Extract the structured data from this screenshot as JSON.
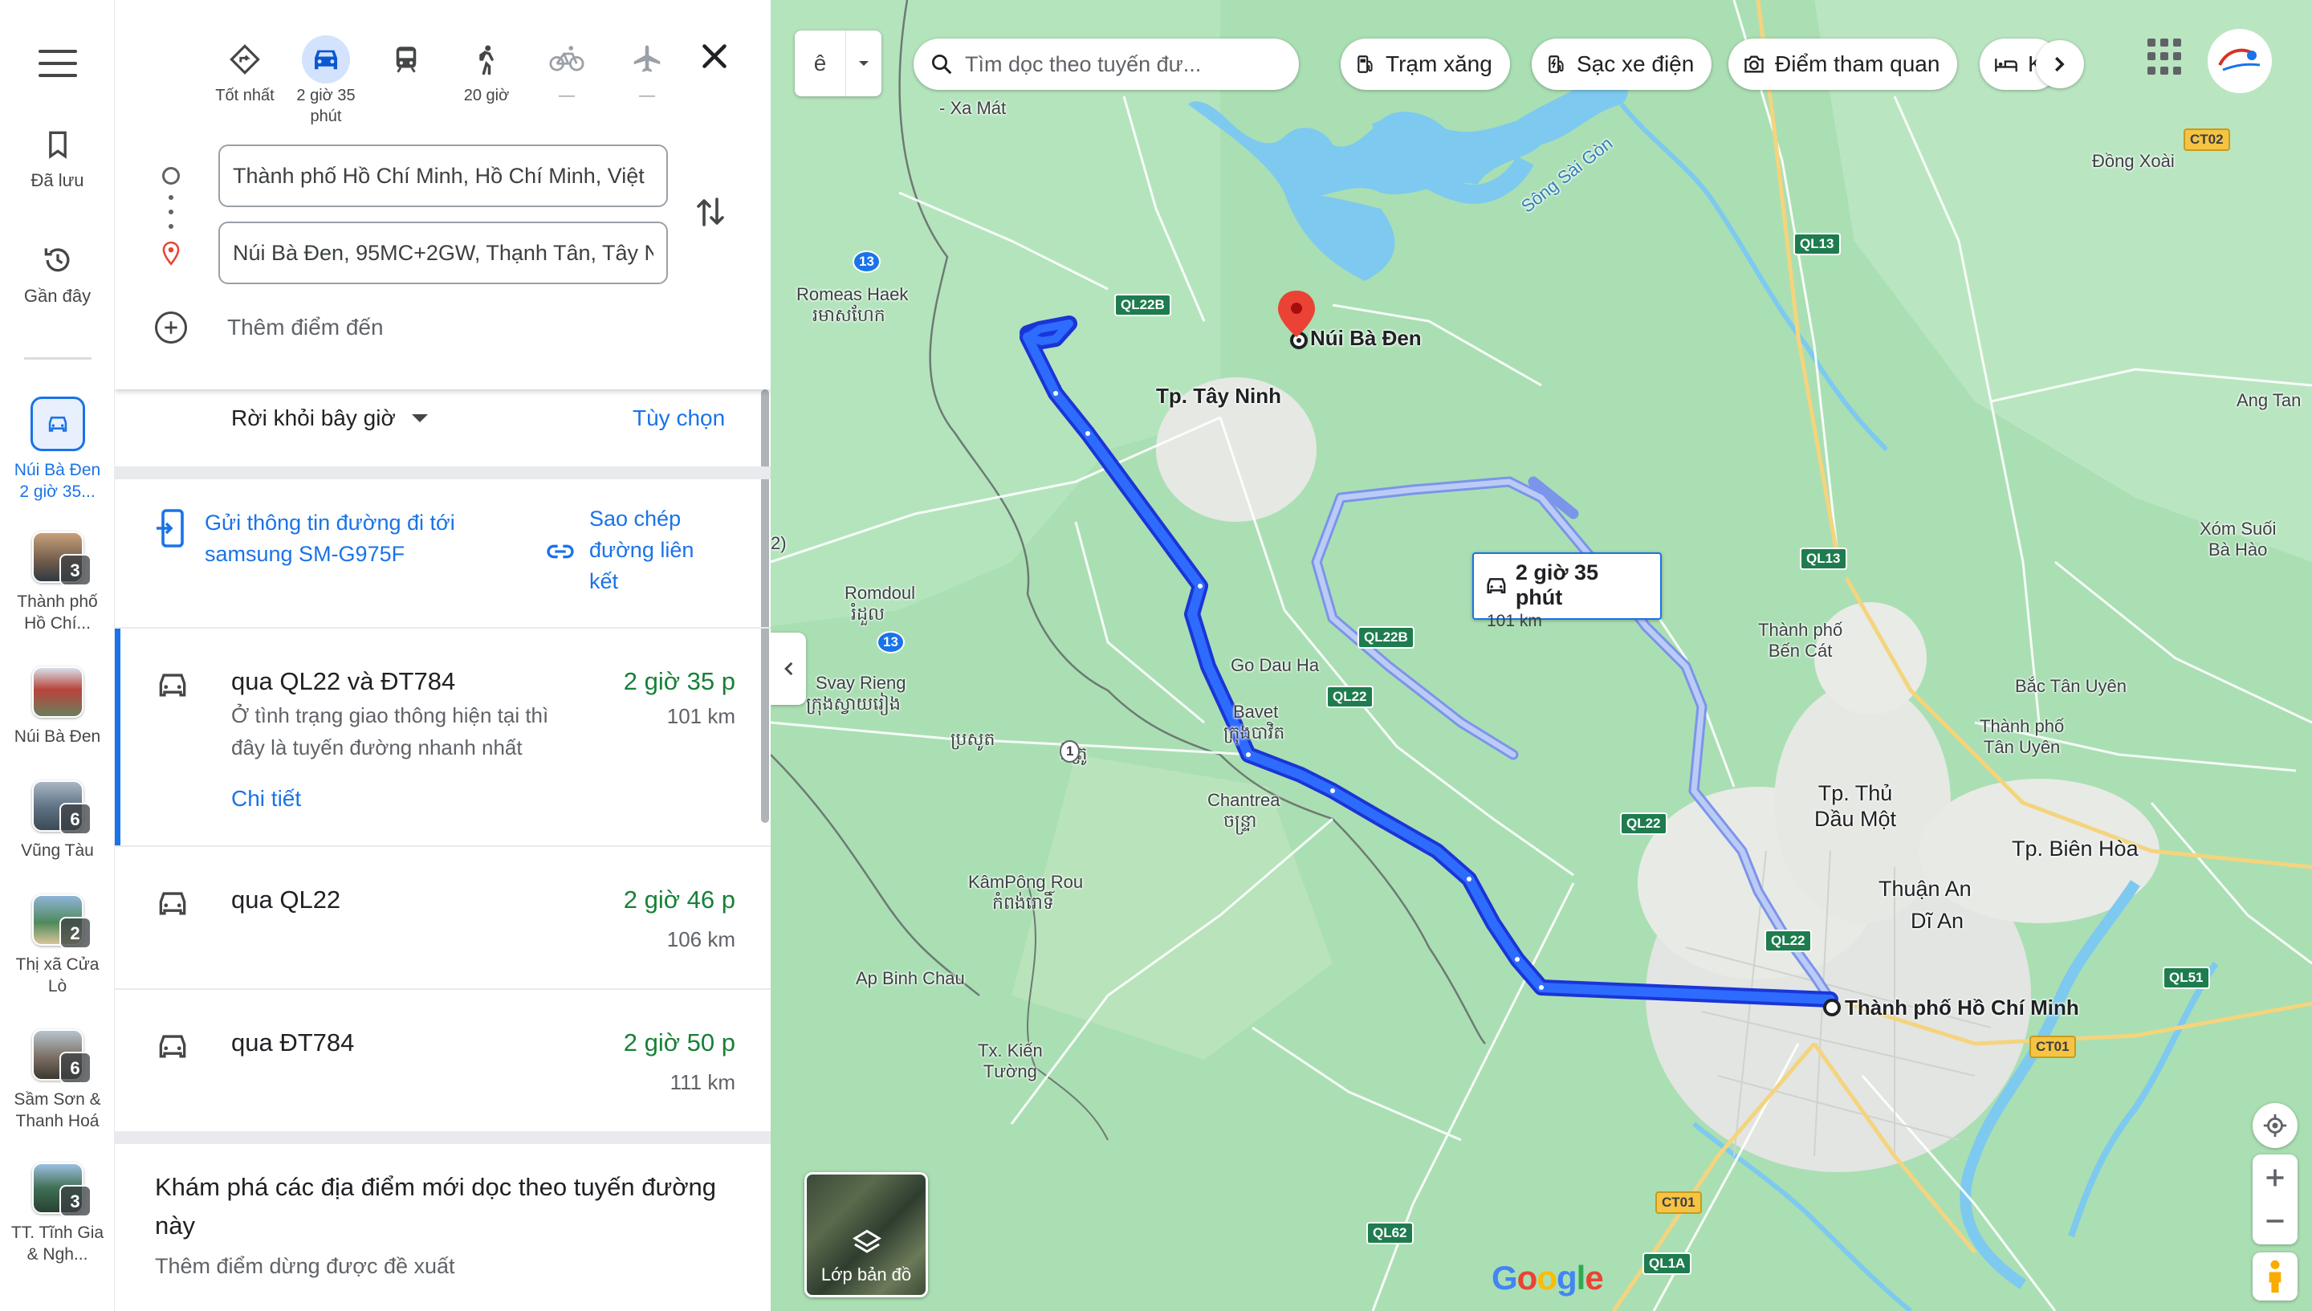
{
  "rail": {
    "saved_label": "Đã lưu",
    "recent_label": "Gần đây",
    "items": [
      {
        "label": "Núi Bà Đen 2 giờ 35...",
        "badge": ""
      },
      {
        "label": "Thành phố Hồ Chí...",
        "badge": "3"
      },
      {
        "label": "Núi Bà Đen",
        "badge": ""
      },
      {
        "label": "Vũng Tàu",
        "badge": "6"
      },
      {
        "label": "Thị xã Cửa Lò",
        "badge": "2"
      },
      {
        "label": "Sầm Sơn & Thanh Hoá",
        "badge": "6"
      },
      {
        "label": "TT. Tĩnh Gia & Ngh...",
        "badge": "3"
      }
    ]
  },
  "modes": [
    {
      "label": "Tốt nhất",
      "icon": "diamond-route-icon"
    },
    {
      "label": "2 giờ 35 phút",
      "icon": "car-icon"
    },
    {
      "label": "",
      "icon": "transit-icon"
    },
    {
      "label": "20 giờ",
      "icon": "walk-icon"
    },
    {
      "label": "—",
      "icon": "bike-icon"
    },
    {
      "label": "—",
      "icon": "plane-icon"
    }
  ],
  "origin": "Thành phố Hồ Chí Minh, Hồ Chí Minh, Việt",
  "destination": "Núi Bà Đen, 95MC+2GW, Thạnh Tân, Tây N",
  "add_destination": "Thêm điểm đến",
  "depart": "Rời khỏi bây giờ",
  "options": "Tùy chọn",
  "send": "Gửi thông tin đường đi tới samsung SM-G975F",
  "copy_link": "Sao chép đường liên kết",
  "routes": [
    {
      "name": "qua QL22 và ĐT784",
      "time": "2 giờ 35 p",
      "distance": "101 km",
      "desc": "Ở tình trạng giao thông hiện tại thì đây là tuyến đường nhanh nhất",
      "details": "Chi tiết"
    },
    {
      "name": "qua QL22",
      "time": "2 giờ 46 p",
      "distance": "106 km"
    },
    {
      "name": "qua ĐT784",
      "time": "2 giờ 50 p",
      "distance": "111 km"
    }
  ],
  "explore": {
    "title": "Khám phá các địa điểm mới dọc theo tuyến đường này",
    "subtitle": "Thêm điểm dừng được đề xuất"
  },
  "map": {
    "search_placeholder": "Tìm dọc theo tuyến đư...",
    "dropdown_icon": "ê",
    "chips": [
      "Trạm xăng",
      "Sạc xe điện",
      "Điểm tham quan",
      "Kh"
    ],
    "callout_time": "2 giờ 35 phút",
    "callout_distance": "101 km",
    "layers_label": "Lớp bản đồ",
    "google": "Google",
    "labels": {
      "xa_mat": "- Xa Mát",
      "romeas": "Romeas Haek",
      "romeas_km": "រមាសហែក",
      "tay_ninh": "Tp. Tây Ninh",
      "nui_ba_den": "Núi Bà Đen",
      "song_sai_gon": "Sông Sài Gòn",
      "dong_xoai": "Đồng Xoài",
      "ang_tan": "Ang Tan",
      "xom_suoi": "Xóm Suối\nBà Hào",
      "romdoul": "Romdoul",
      "romdoul_km": "រំដួល",
      "svay_rieng": "Svay Rieng",
      "svay_rieng_km": "ក្រុងស្វាយរៀង",
      "go_dau_ha": "Go Dau Ha",
      "bavet": "Bavet",
      "bavet_km": "ក្រុងបាវិត",
      "prasout": "ប្រសូត",
      "chantrea": "Chantrea",
      "chantrea_km": "ចន្ទ្រា",
      "ben_cat": "Thành phố\nBến Cát",
      "bac_tan_uyen": "Bắc Tân Uyên",
      "tan_uyen": "Thành phố\nTân Uyên",
      "thu_dau_mot": "Tp. Thủ\nDầu Một",
      "bien_hoa": "Tp. Biên Hòa",
      "thuan_an": "Thuận An",
      "di_an": "Dĩ An",
      "kampong_rou": "KâmPông Rou",
      "kampong_rou_km": "កំពង់រោទិ៍",
      "ap_binh_chau": "Ap Binh Chau",
      "kien_tuong": "Tx. Kiến\nTường",
      "hcm": "Thành phố Hồ Chí Minh",
      "chitrou": "ជិត្រូ",
      "shield_2": "2)"
    },
    "shields": {
      "ql22b_top": "QL22B",
      "ql13_top": "QL13",
      "ct02": "CT02",
      "r13": "13",
      "r1": "1",
      "ql13_mid": "QL13",
      "ql22b_mid": "QL22B",
      "ql22_left": "QL22",
      "ql22_mid": "QL22",
      "ql22_low": "QL22",
      "ql51": "QL51",
      "ct01_r": "CT01",
      "ct01_b": "CT01",
      "ql62": "QL62",
      "ql1a": "QL1A",
      "r13b": "13"
    }
  }
}
